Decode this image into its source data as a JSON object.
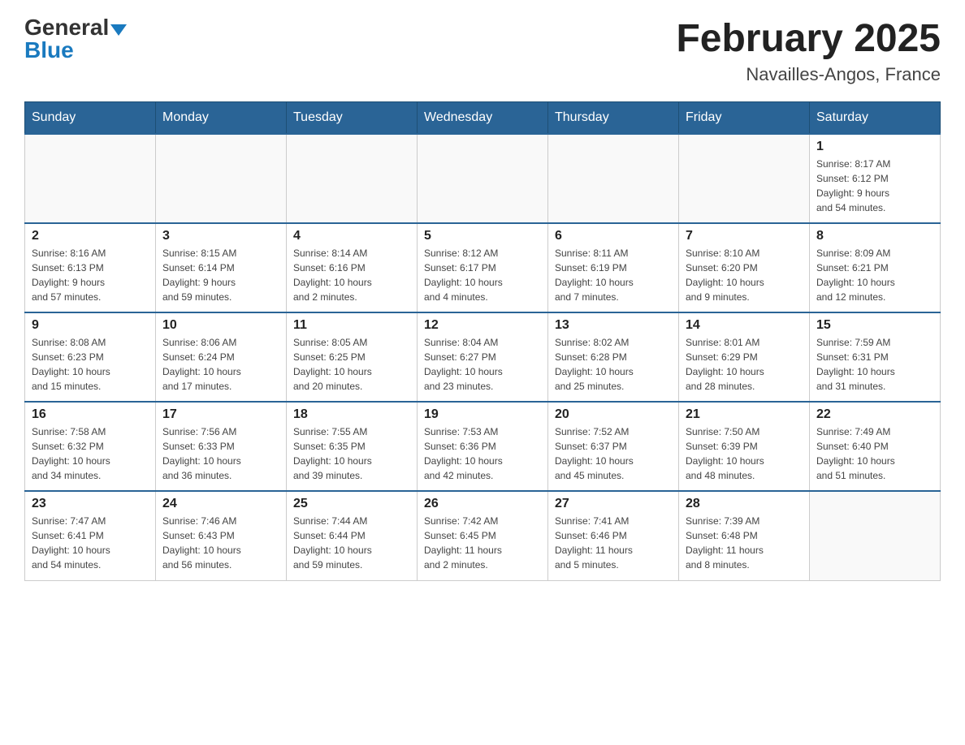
{
  "header": {
    "logo_general": "General",
    "logo_blue": "Blue",
    "month_title": "February 2025",
    "location": "Navailles-Angos, France"
  },
  "weekdays": [
    "Sunday",
    "Monday",
    "Tuesday",
    "Wednesday",
    "Thursday",
    "Friday",
    "Saturday"
  ],
  "weeks": [
    [
      {
        "day": "",
        "info": ""
      },
      {
        "day": "",
        "info": ""
      },
      {
        "day": "",
        "info": ""
      },
      {
        "day": "",
        "info": ""
      },
      {
        "day": "",
        "info": ""
      },
      {
        "day": "",
        "info": ""
      },
      {
        "day": "1",
        "info": "Sunrise: 8:17 AM\nSunset: 6:12 PM\nDaylight: 9 hours\nand 54 minutes."
      }
    ],
    [
      {
        "day": "2",
        "info": "Sunrise: 8:16 AM\nSunset: 6:13 PM\nDaylight: 9 hours\nand 57 minutes."
      },
      {
        "day": "3",
        "info": "Sunrise: 8:15 AM\nSunset: 6:14 PM\nDaylight: 9 hours\nand 59 minutes."
      },
      {
        "day": "4",
        "info": "Sunrise: 8:14 AM\nSunset: 6:16 PM\nDaylight: 10 hours\nand 2 minutes."
      },
      {
        "day": "5",
        "info": "Sunrise: 8:12 AM\nSunset: 6:17 PM\nDaylight: 10 hours\nand 4 minutes."
      },
      {
        "day": "6",
        "info": "Sunrise: 8:11 AM\nSunset: 6:19 PM\nDaylight: 10 hours\nand 7 minutes."
      },
      {
        "day": "7",
        "info": "Sunrise: 8:10 AM\nSunset: 6:20 PM\nDaylight: 10 hours\nand 9 minutes."
      },
      {
        "day": "8",
        "info": "Sunrise: 8:09 AM\nSunset: 6:21 PM\nDaylight: 10 hours\nand 12 minutes."
      }
    ],
    [
      {
        "day": "9",
        "info": "Sunrise: 8:08 AM\nSunset: 6:23 PM\nDaylight: 10 hours\nand 15 minutes."
      },
      {
        "day": "10",
        "info": "Sunrise: 8:06 AM\nSunset: 6:24 PM\nDaylight: 10 hours\nand 17 minutes."
      },
      {
        "day": "11",
        "info": "Sunrise: 8:05 AM\nSunset: 6:25 PM\nDaylight: 10 hours\nand 20 minutes."
      },
      {
        "day": "12",
        "info": "Sunrise: 8:04 AM\nSunset: 6:27 PM\nDaylight: 10 hours\nand 23 minutes."
      },
      {
        "day": "13",
        "info": "Sunrise: 8:02 AM\nSunset: 6:28 PM\nDaylight: 10 hours\nand 25 minutes."
      },
      {
        "day": "14",
        "info": "Sunrise: 8:01 AM\nSunset: 6:29 PM\nDaylight: 10 hours\nand 28 minutes."
      },
      {
        "day": "15",
        "info": "Sunrise: 7:59 AM\nSunset: 6:31 PM\nDaylight: 10 hours\nand 31 minutes."
      }
    ],
    [
      {
        "day": "16",
        "info": "Sunrise: 7:58 AM\nSunset: 6:32 PM\nDaylight: 10 hours\nand 34 minutes."
      },
      {
        "day": "17",
        "info": "Sunrise: 7:56 AM\nSunset: 6:33 PM\nDaylight: 10 hours\nand 36 minutes."
      },
      {
        "day": "18",
        "info": "Sunrise: 7:55 AM\nSunset: 6:35 PM\nDaylight: 10 hours\nand 39 minutes."
      },
      {
        "day": "19",
        "info": "Sunrise: 7:53 AM\nSunset: 6:36 PM\nDaylight: 10 hours\nand 42 minutes."
      },
      {
        "day": "20",
        "info": "Sunrise: 7:52 AM\nSunset: 6:37 PM\nDaylight: 10 hours\nand 45 minutes."
      },
      {
        "day": "21",
        "info": "Sunrise: 7:50 AM\nSunset: 6:39 PM\nDaylight: 10 hours\nand 48 minutes."
      },
      {
        "day": "22",
        "info": "Sunrise: 7:49 AM\nSunset: 6:40 PM\nDaylight: 10 hours\nand 51 minutes."
      }
    ],
    [
      {
        "day": "23",
        "info": "Sunrise: 7:47 AM\nSunset: 6:41 PM\nDaylight: 10 hours\nand 54 minutes."
      },
      {
        "day": "24",
        "info": "Sunrise: 7:46 AM\nSunset: 6:43 PM\nDaylight: 10 hours\nand 56 minutes."
      },
      {
        "day": "25",
        "info": "Sunrise: 7:44 AM\nSunset: 6:44 PM\nDaylight: 10 hours\nand 59 minutes."
      },
      {
        "day": "26",
        "info": "Sunrise: 7:42 AM\nSunset: 6:45 PM\nDaylight: 11 hours\nand 2 minutes."
      },
      {
        "day": "27",
        "info": "Sunrise: 7:41 AM\nSunset: 6:46 PM\nDaylight: 11 hours\nand 5 minutes."
      },
      {
        "day": "28",
        "info": "Sunrise: 7:39 AM\nSunset: 6:48 PM\nDaylight: 11 hours\nand 8 minutes."
      },
      {
        "day": "",
        "info": ""
      }
    ]
  ]
}
